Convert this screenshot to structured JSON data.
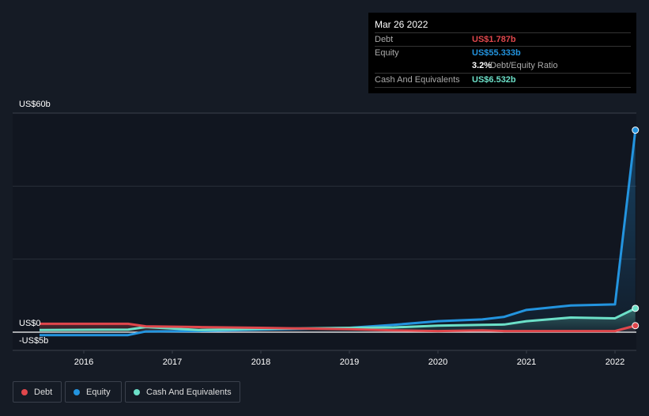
{
  "tooltip": {
    "date": "Mar 26 2022",
    "debt_label": "Debt",
    "debt_value": "US$1.787b",
    "equity_label": "Equity",
    "equity_value": "US$55.333b",
    "ratio_value": "3.2%",
    "ratio_label": "Debt/Equity Ratio",
    "cash_label": "Cash And Equivalents",
    "cash_value": "US$6.532b"
  },
  "legend": [
    {
      "label": "Debt",
      "color": "#e0474c"
    },
    {
      "label": "Equity",
      "color": "#2394df"
    },
    {
      "label": "Cash And Equivalents",
      "color": "#6ce0c8"
    }
  ],
  "chart_data": {
    "type": "line",
    "ylim": [
      -5,
      60
    ],
    "y_ticks": [
      {
        "value": 60,
        "label": "US$60b"
      },
      {
        "value": 0,
        "label": "US$0"
      },
      {
        "value": -5,
        "label": "-US$5b"
      }
    ],
    "x_ticks": [
      "2016",
      "2017",
      "2018",
      "2019",
      "2020",
      "2021",
      "2022"
    ],
    "grid": true,
    "legend_placement": "bottom-left",
    "x": [
      2015.5,
      2016.5,
      2016.7,
      2017.3,
      2018,
      2019,
      2019.5,
      2020,
      2020.5,
      2020.75,
      2021.0,
      2021.5,
      2022.0,
      2022.23
    ],
    "series": [
      {
        "name": "Debt",
        "color": "#e0474c",
        "values": [
          2.3,
          2.3,
          1.6,
          1.4,
          1.2,
          0.8,
          0.5,
          0.3,
          0.5,
          0.3,
          0.3,
          0.3,
          0.3,
          1.787
        ]
      },
      {
        "name": "Equity",
        "color": "#2394df",
        "values": [
          -0.8,
          -0.8,
          0.2,
          0.3,
          0.7,
          1.2,
          2.0,
          3.0,
          3.5,
          4.2,
          6.1,
          7.3,
          7.6,
          55.333
        ]
      },
      {
        "name": "Cash And Equivalents",
        "color": "#6ce0c8",
        "values": [
          0.6,
          0.7,
          1.4,
          0.6,
          0.9,
          1.2,
          1.3,
          1.8,
          2.0,
          2.1,
          3.0,
          4.0,
          3.8,
          6.532
        ]
      }
    ]
  }
}
